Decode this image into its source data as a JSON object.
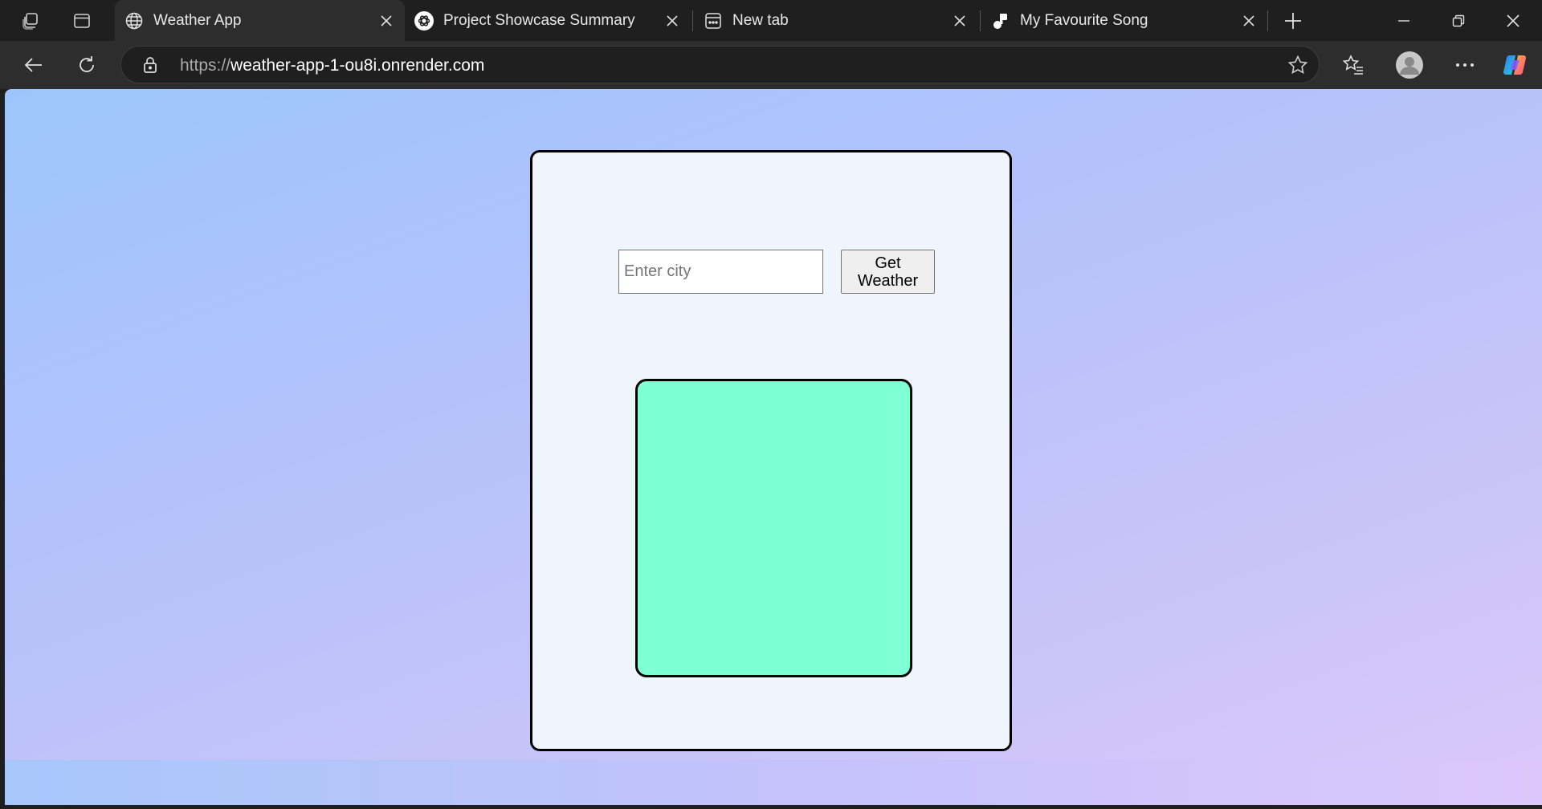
{
  "browser": {
    "tabs": [
      {
        "title": "Weather App",
        "icon": "globe-icon",
        "active": true
      },
      {
        "title": "Project Showcase Summary",
        "icon": "chatgpt-icon",
        "active": false
      },
      {
        "title": "New tab",
        "icon": "newtab-icon",
        "active": false
      },
      {
        "title": "My Favourite Song",
        "icon": "music-note-icon",
        "active": false
      }
    ],
    "url_scheme": "https://",
    "url_host": "weather-app-1-ou8i.onrender.com"
  },
  "page": {
    "city_placeholder": "Enter city",
    "city_value": "",
    "button_label": "Get\nWeather",
    "result_bg": "#7fffd4",
    "card_bg": "#eef5fd"
  }
}
